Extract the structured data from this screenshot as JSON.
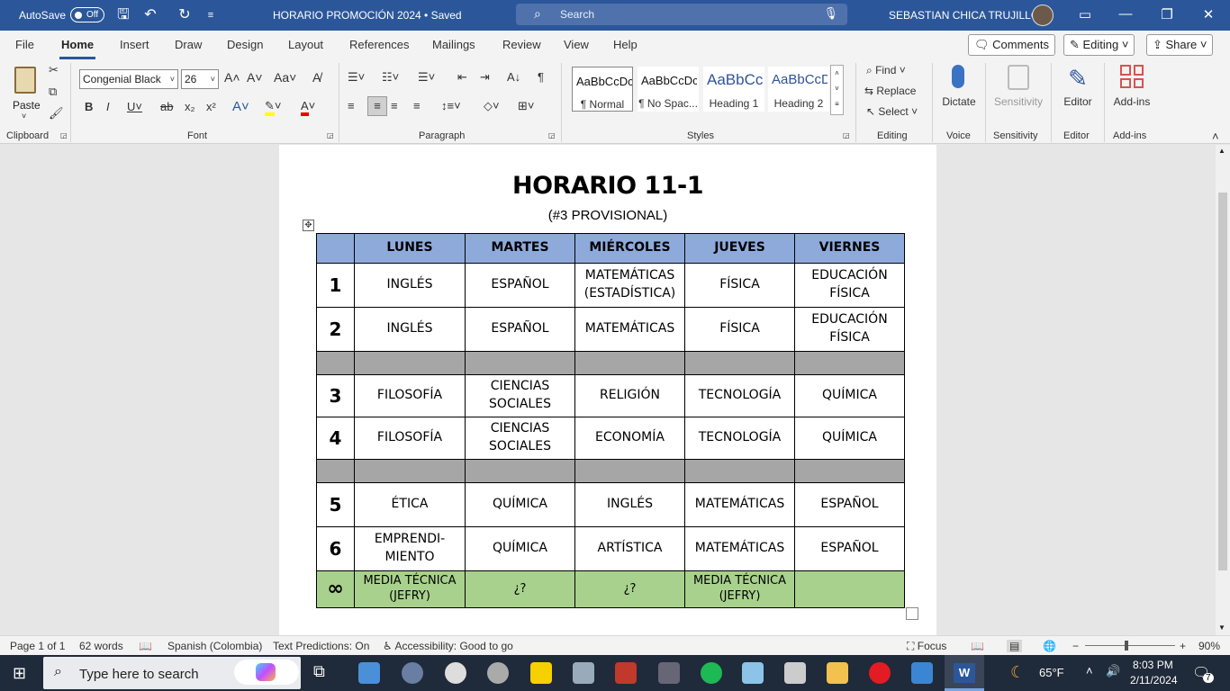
{
  "titlebar": {
    "autosave_label": "AutoSave",
    "autosave_state": "Off",
    "doc_name": "HORARIO PROMOCIÓN 2024 • Saved",
    "search_placeholder": "Search",
    "user": "SEBASTIAN CHICA TRUJILLO"
  },
  "menu": {
    "tabs": [
      "File",
      "Home",
      "Insert",
      "Draw",
      "Design",
      "Layout",
      "References",
      "Mailings",
      "Review",
      "View",
      "Help"
    ],
    "active_tab": "Home",
    "comments": "Comments",
    "editing": "Editing",
    "share": "Share"
  },
  "ribbon": {
    "clipboard": {
      "paste": "Paste",
      "label": "Clipboard"
    },
    "font": {
      "name": "Congenial Black",
      "size": "26",
      "label": "Font"
    },
    "paragraph": {
      "label": "Paragraph"
    },
    "styles": {
      "label": "Styles",
      "items": [
        {
          "preview": "AaBbCcDc",
          "name": "¶ Normal"
        },
        {
          "preview": "AaBbCcDc",
          "name": "¶ No Spac..."
        },
        {
          "preview": "AaBbCc",
          "name": "Heading 1"
        },
        {
          "preview": "AaBbCcD",
          "name": "Heading 2"
        }
      ]
    },
    "editing": {
      "find": "Find",
      "replace": "Replace",
      "select": "Select",
      "label": "Editing"
    },
    "voice": {
      "dictate": "Dictate",
      "label": "Voice"
    },
    "sensitivity": {
      "button": "Sensitivity",
      "label": "Sensitivity"
    },
    "editor": {
      "button": "Editor",
      "label": "Editor"
    },
    "addins": {
      "button": "Add-ins",
      "label": "Add-ins"
    }
  },
  "document": {
    "title": "HORARIO 11-1",
    "subtitle": "(#3 PROVISIONAL)",
    "table": {
      "headers": [
        "",
        "LUNES",
        "MARTES",
        "MIÉRCOLES",
        "JUEVES",
        "VIERNES"
      ],
      "rows": [
        {
          "num": "1",
          "cells": [
            "INGLÉS",
            "ESPAÑOL",
            "MATEMÁTICAS (ESTADÍSTICA)",
            "FÍSICA",
            "EDUCACIÓN FÍSICA"
          ]
        },
        {
          "num": "2",
          "cells": [
            "INGLÉS",
            "ESPAÑOL",
            "MATEMÁTICAS",
            "FÍSICA",
            "EDUCACIÓN FÍSICA"
          ]
        },
        {
          "num": "3",
          "cells": [
            "FILOSOFÍA",
            "CIENCIAS SOCIALES",
            "RELIGIÓN",
            "TECNOLOGÍA",
            "QUÍMICA"
          ]
        },
        {
          "num": "4",
          "cells": [
            "FILOSOFÍA",
            "CIENCIAS SOCIALES",
            "ECONOMÍA",
            "TECNOLOGÍA",
            "QUÍMICA"
          ]
        },
        {
          "num": "5",
          "cells": [
            "ÉTICA",
            "QUÍMICA",
            "INGLÉS",
            "MATEMÁTICAS",
            "ESPAÑOL"
          ]
        },
        {
          "num": "6",
          "cells": [
            "EMPRENDI-MIENTO",
            "QUÍMICA",
            "ARTÍSTICA",
            "MATEMÁTICAS",
            "ESPAÑOL"
          ]
        }
      ],
      "media": {
        "num": "∞",
        "cells": [
          "MEDIA TÉCNICA (JEFRY)",
          "¿?",
          "¿?",
          "MEDIA TÉCNICA (JEFRY)",
          ""
        ]
      }
    }
  },
  "status": {
    "page": "Page 1 of 1",
    "words": "62 words",
    "language": "Spanish (Colombia)",
    "predictions": "Text Predictions: On",
    "accessibility": "Accessibility: Good to go",
    "focus": "Focus",
    "zoom": "90%"
  },
  "taskbar": {
    "search_placeholder": "Type here to search",
    "weather": "65°F",
    "time": "8:03 PM",
    "date": "2/11/2024",
    "notifications": "7"
  },
  "colors": {
    "word_blue": "#2b579a",
    "header_fill": "#8eaadb",
    "break_fill": "#a6a6a6",
    "media_fill": "#a9d18e"
  }
}
